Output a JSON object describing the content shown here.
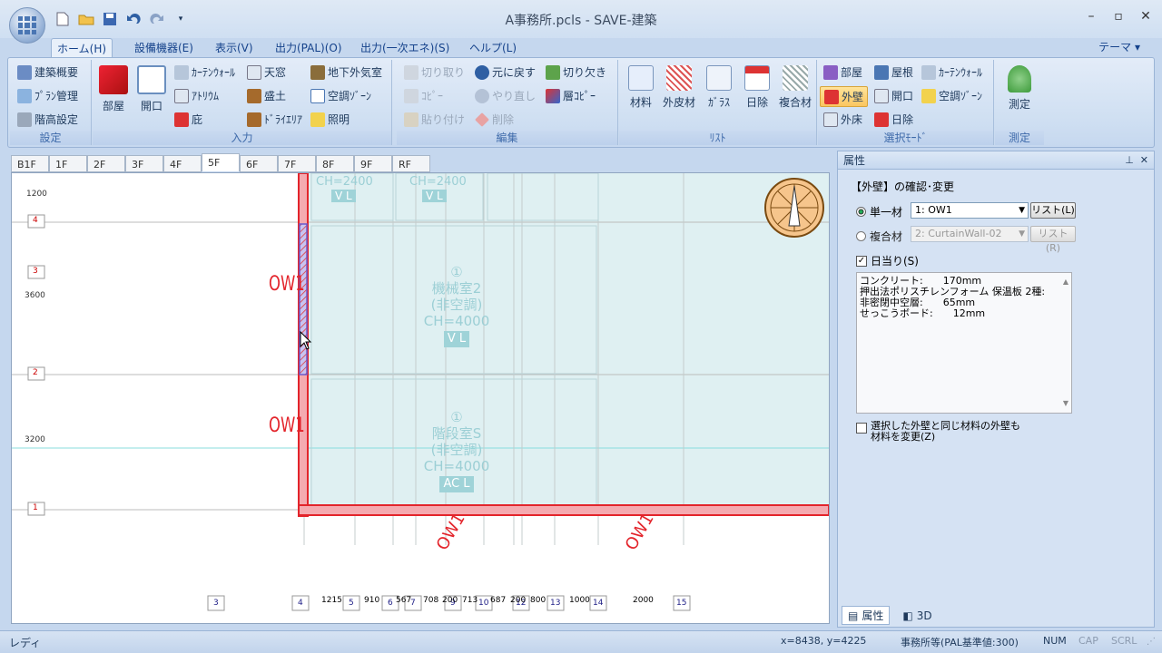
{
  "window": {
    "title": "A事務所.pcls - SAVE-建築"
  },
  "ribbon_tabs": [
    "ホーム(H)",
    "設備機器(E)",
    "表示(V)",
    "出力(PAL)(O)",
    "出力(一次エネ)(S)",
    "ヘルプ(L)"
  ],
  "theme_label": "テーマ",
  "groups": {
    "settings": {
      "label": "設定",
      "items": [
        "建築概要",
        "ﾌﾟﾗﾝ管理",
        "階高設定"
      ]
    },
    "input": {
      "label": "入力",
      "big": [
        "部屋",
        "開口"
      ],
      "items": [
        "ｶｰﾃﾝｳｫｰﾙ",
        "天窓",
        "地下外気室",
        "ｱﾄﾘｳﾑ",
        "盛土",
        "空調ｿﾞｰﾝ",
        "庇",
        "ﾄﾞﾗｲｴﾘｱ",
        "照明"
      ]
    },
    "edit": {
      "label": "編集",
      "items": [
        "切り取り",
        "元に戻す",
        "切り欠き",
        "ｺﾋﾟｰ",
        "やり直し",
        "層ｺﾋﾟｰ",
        "貼り付け",
        "削除"
      ]
    },
    "list": {
      "label": "ﾘｽﾄ",
      "items": [
        "材料",
        "外皮材",
        "ｶﾞﾗｽ",
        "日除",
        "複合材"
      ]
    },
    "select_mode": {
      "label": "選択ﾓｰﾄﾞ",
      "items": [
        "部屋",
        "屋根",
        "ｶｰﾃﾝｳｫｰﾙ",
        "外壁",
        "開口",
        "空調ｿﾞｰﾝ",
        "外床",
        "日除"
      ]
    },
    "measure": {
      "label": "測定",
      "items": [
        "測定"
      ]
    }
  },
  "floor_tabs": [
    "B1F",
    "1F",
    "2F",
    "3F",
    "4F",
    "5F",
    "6F",
    "7F",
    "8F",
    "9F",
    "RF"
  ],
  "active_floor": "5F",
  "drawing": {
    "left_dims": [
      "1200",
      "3600",
      "3200"
    ],
    "row_markers": [
      "4",
      "3",
      "2",
      "1"
    ],
    "wall_labels": [
      "OW1",
      "OW1",
      "OW1",
      "OW1"
    ],
    "rooms": [
      {
        "num": "①",
        "name": "機械室2",
        "ac": "(非空調)",
        "ch": "CH=4000",
        "tag": "V L"
      },
      {
        "num": "①",
        "name": "階段室S",
        "ac": "(非空調)",
        "ch": "CH=4000",
        "tag": "AC  L"
      }
    ],
    "top_rooms": [
      {
        "ch": "CH=2400",
        "tag": "V L"
      },
      {
        "ch": "CH=2400",
        "tag": "V L"
      }
    ],
    "bottom_markers": [
      "3",
      "4",
      "5",
      "6",
      "7",
      "9",
      "10",
      "12",
      "13",
      "14",
      "15"
    ],
    "bottom_dims": [
      "1215",
      "910",
      "567",
      "708",
      "200",
      "713",
      "687",
      "200",
      "800",
      "1000",
      "2000"
    ]
  },
  "panel": {
    "title": "属性",
    "heading": "【外壁】の確認･変更",
    "single_label": "単一材",
    "single_value": "1: OW1",
    "list_button": "リスト(L)",
    "composite_label": "複合材",
    "composite_value": "2: CurtainWall-02",
    "list_button_r": "リスト(R)",
    "sun_label": "日当り(S)",
    "materials": [
      "コンクリート:　　170mm",
      "押出法ポリスチレンフォーム 保温板 2種:",
      "非密閉中空層:　　65mm",
      "せっこうボード:　　12mm"
    ],
    "change_label_1": "選択した外壁と同じ材料の外壁も",
    "change_label_2": "材料を変更(Z)",
    "tabs": [
      "属性",
      "3D"
    ]
  },
  "status": {
    "ready": "レディ",
    "coords": "x=8438, y=4225",
    "standard": "事務所等(PAL基準値:300)",
    "num": "NUM",
    "cap": "CAP",
    "scrl": "SCRL"
  }
}
